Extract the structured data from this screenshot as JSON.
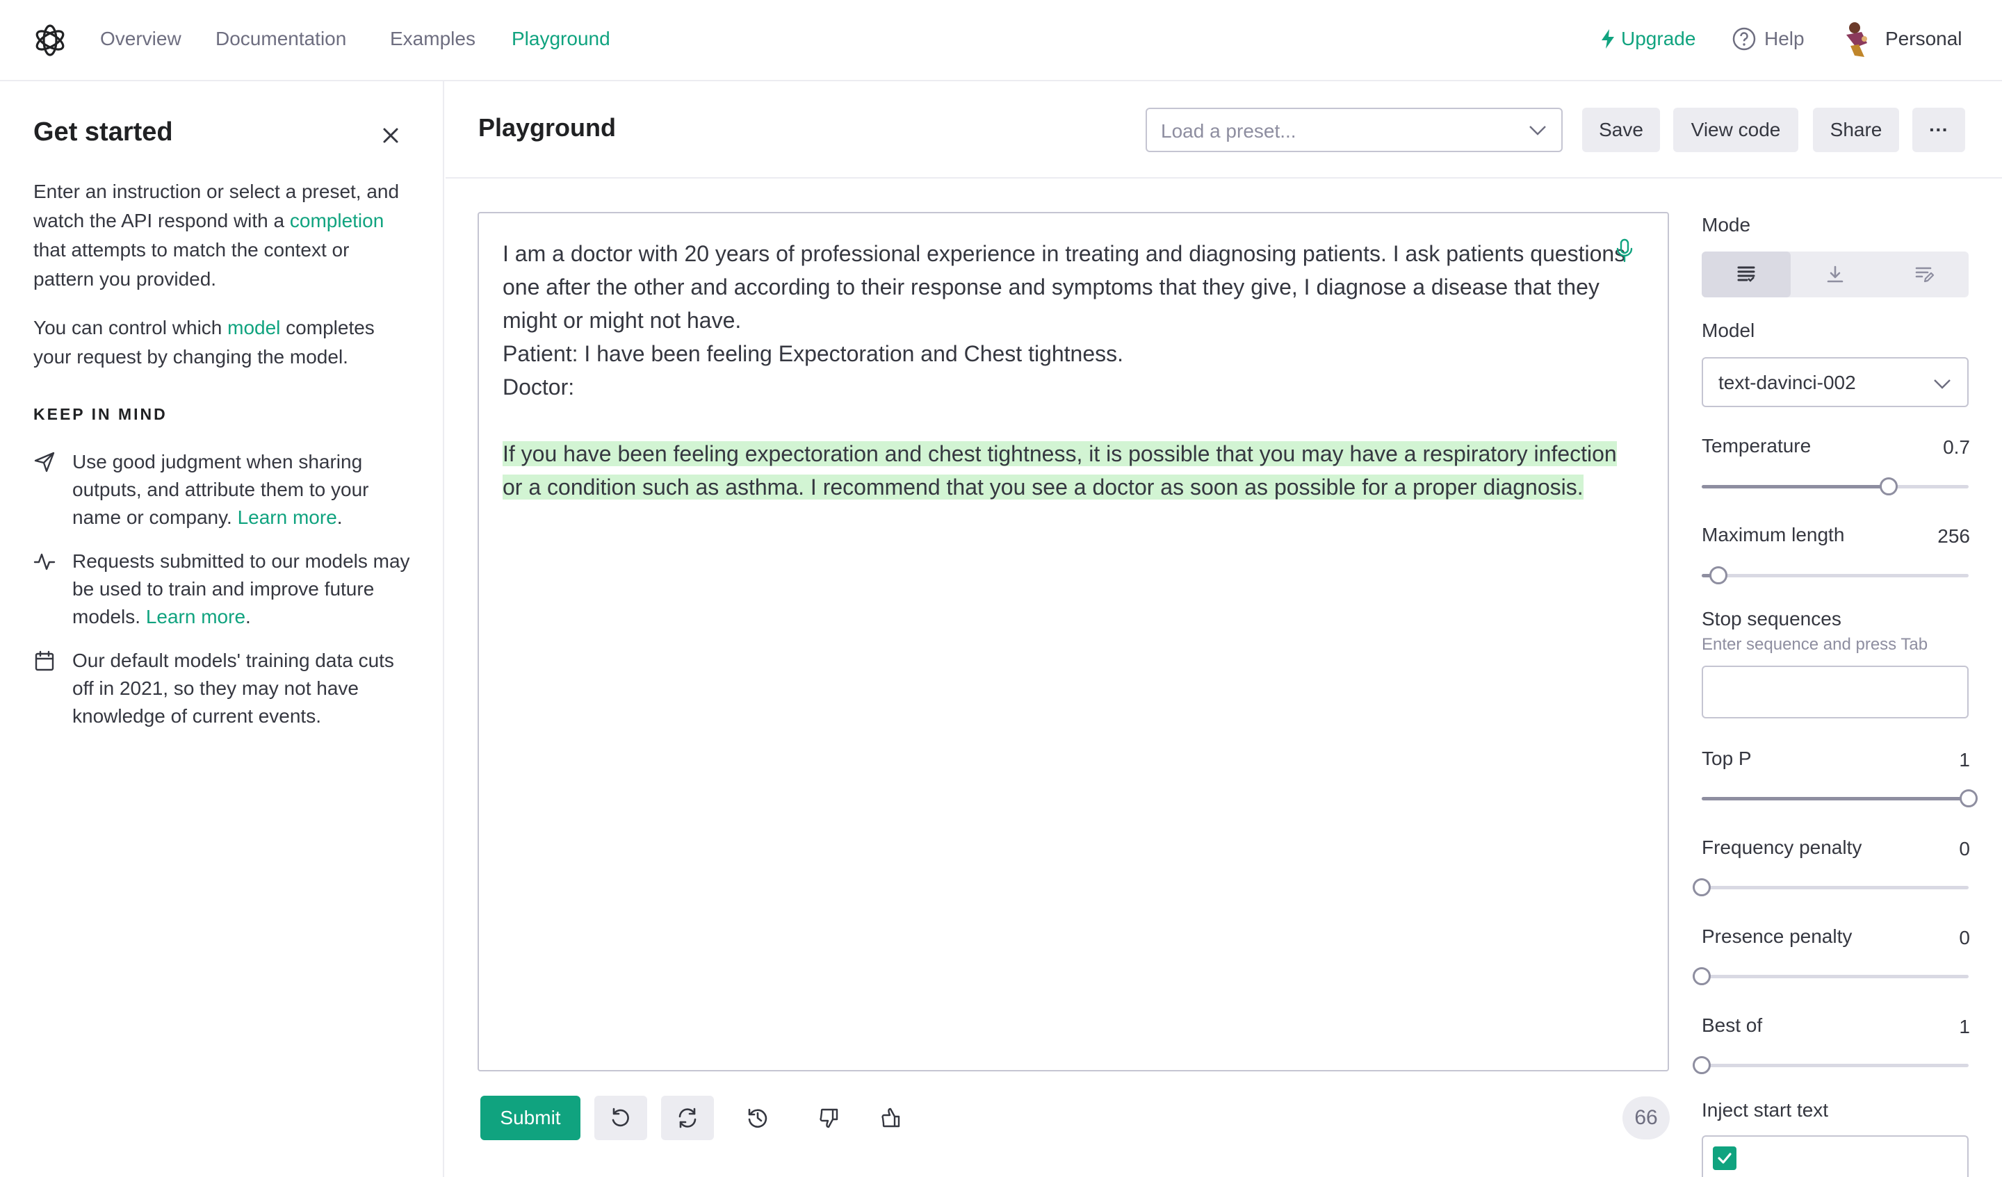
{
  "nav": {
    "links": [
      "Overview",
      "Documentation",
      "Examples",
      "Playground"
    ],
    "active": "Playground",
    "upgrade": "Upgrade",
    "help": "Help",
    "account": "Personal"
  },
  "sidebar": {
    "title": "Get started",
    "intro_before": "Enter an instruction or select a preset, and watch the API respond with a ",
    "intro_link": "completion",
    "intro_after": " that attempts to match the context or pattern you provided.",
    "model_before": "You can control which ",
    "model_link": "model",
    "model_after": " completes your request by changing the model.",
    "keep_in_mind": "KEEP IN MIND",
    "tips": [
      {
        "icon": "send-icon",
        "text": "Use good judgment when sharing outputs, and attribute them to your name or company. ",
        "link": "Learn more"
      },
      {
        "icon": "activity-icon",
        "text": "Requests submitted to our models may be used to train and improve future models. ",
        "link": "Learn more"
      },
      {
        "icon": "calendar-icon",
        "text": "Our default models' training data cuts off in 2021, so they may not have knowledge of current events.",
        "link": ""
      }
    ]
  },
  "header": {
    "title": "Playground",
    "preset_placeholder": "Load a preset...",
    "save": "Save",
    "view_code": "View code",
    "share": "Share",
    "more": "···"
  },
  "editor": {
    "prompt": "I am a doctor with 20 years of professional experience in treating and diagnosing patients. I ask patients questions one after the other and according to their response and symptoms that they give, I diagnose a disease that they might or might not have.\nPatient: I have been feeling Expectoration and Chest tightness.\nDoctor:",
    "completion": "If you have been feeling expectoration and chest tightness, it is possible that you may have a respiratory infection or a condition such as asthma. I recommend that you see a doctor as soon as possible for a proper diagnosis."
  },
  "toolbar": {
    "submit": "Submit",
    "token_count": "66"
  },
  "settings": {
    "mode_label": "Mode",
    "modes": [
      "complete-icon",
      "insert-icon",
      "edit-icon"
    ],
    "model_label": "Model",
    "model_value": "text-davinci-002",
    "temperature": {
      "label": "Temperature",
      "value": "0.7",
      "fraction": 0.7
    },
    "max_length": {
      "label": "Maximum length",
      "value": "256",
      "fraction": 0.062
    },
    "stop": {
      "label": "Stop sequences",
      "hint": "Enter sequence and press Tab"
    },
    "top_p": {
      "label": "Top P",
      "value": "1",
      "fraction": 1.0
    },
    "frequency_penalty": {
      "label": "Frequency penalty",
      "value": "0",
      "fraction": 0
    },
    "presence_penalty": {
      "label": "Presence penalty",
      "value": "0",
      "fraction": 0
    },
    "best_of": {
      "label": "Best of",
      "value": "1",
      "fraction": 0
    },
    "inject_start": {
      "label": "Inject start text",
      "checked": true
    }
  },
  "colors": {
    "accent": "#10a37f",
    "highlight": "#d2f4d3",
    "border": "#c5c5d2"
  }
}
